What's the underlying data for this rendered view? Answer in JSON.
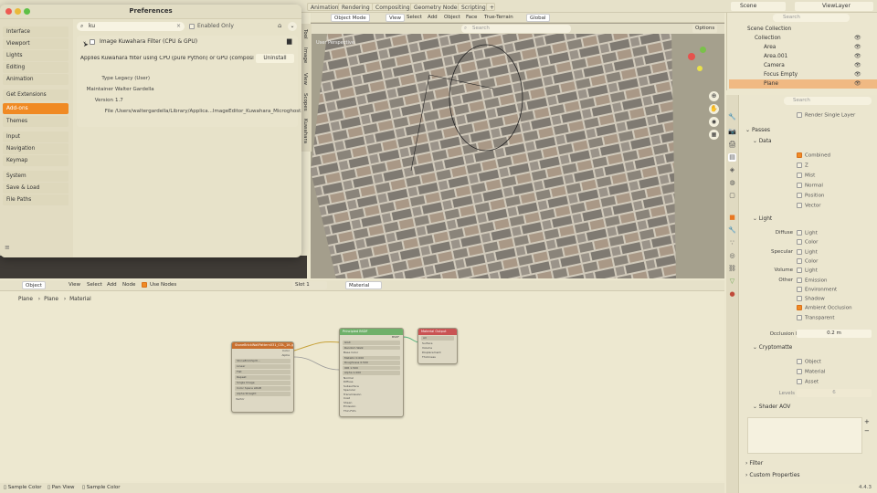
{
  "menubar": {
    "items": [
      "File",
      "Edit",
      "Render",
      "Window",
      "Help"
    ]
  },
  "workspace_tabs": [
    "Animation",
    "Rendering",
    "Compositing",
    "Geometry Nodes",
    "Scripting"
  ],
  "scene": {
    "scene_label": "Scene",
    "view_layer_label": "ViewLayer",
    "search_placeholder": "Search"
  },
  "preferences": {
    "title": "Preferences",
    "search_value": "ku",
    "enabled_only_label": "Enabled Only",
    "sidebar": [
      {
        "label": "Interface"
      },
      {
        "label": "Viewport"
      },
      {
        "label": "Lights"
      },
      {
        "label": "Editing"
      },
      {
        "label": "Animation"
      },
      {
        "label": "Get Extensions"
      },
      {
        "label": "Add-ons"
      },
      {
        "label": "Themes"
      },
      {
        "label": "Input"
      },
      {
        "label": "Navigation"
      },
      {
        "label": "Keymap"
      },
      {
        "label": "System"
      },
      {
        "label": "Save & Load"
      },
      {
        "label": "File Paths"
      }
    ],
    "addon": {
      "name": "Image Kuwahara Filter (CPU & GPU)",
      "description": "Applies Kuwahara filter using CPU (pure Python) or GPU (compositor) ...",
      "uninstall_label": "Uninstall",
      "fields": [
        {
          "key": "Type",
          "value": "Legacy (User)"
        },
        {
          "key": "Maintainer",
          "value": "Walter Gardella"
        },
        {
          "key": "Version",
          "value": "1.7"
        },
        {
          "key": "File",
          "value": "/Users/waltergardella/Library/Applica...ImageEditor_Kuwahara_Microghost.py"
        }
      ]
    }
  },
  "viewport": {
    "mode": "Object Mode",
    "menus": [
      "View",
      "Select",
      "Add",
      "Object",
      "Face",
      "True-Terrain"
    ],
    "orientation": "Global",
    "options_label": "Options",
    "search_placeholder": "Search",
    "side_tabs": [
      "Tool",
      "Image",
      "View",
      "Scopes",
      "Kuwahara"
    ],
    "overlay_text": "User Perspective"
  },
  "outliner": {
    "collection_label": "Scene Collection",
    "items": [
      {
        "label": "Collection"
      },
      {
        "label": "Area"
      },
      {
        "label": "Area.001"
      },
      {
        "label": "Camera"
      },
      {
        "label": "Focus Empty"
      },
      {
        "label": "Plane"
      }
    ]
  },
  "properties": {
    "render_single_layer": "Render Single Layer",
    "passes_label": "Passes",
    "data_label": "Data",
    "data_items": [
      {
        "label": "Combined",
        "on": true
      },
      {
        "label": "Z",
        "on": false
      },
      {
        "label": "Mist",
        "on": false
      },
      {
        "label": "Normal",
        "on": false
      },
      {
        "label": "Position",
        "on": false
      },
      {
        "label": "Vector",
        "on": false
      }
    ],
    "light_label": "Light",
    "light_rows": [
      {
        "group": "Diffuse",
        "label": "Light"
      },
      {
        "group": "",
        "label": "Color"
      },
      {
        "group": "Specular",
        "label": "Light"
      },
      {
        "group": "",
        "label": "Color"
      },
      {
        "group": "Volume",
        "label": "Light"
      },
      {
        "group": "Other",
        "label": "Emission"
      },
      {
        "group": "",
        "label": "Environment"
      },
      {
        "group": "",
        "label": "Shadow"
      },
      {
        "group": "",
        "label": "Ambient Occlusion",
        "on": true
      },
      {
        "group": "",
        "label": "Transparent"
      }
    ],
    "occlusion_label": "Occlusion Distance",
    "occlusion_value": "0.2 m",
    "cryptomatte_label": "Cryptomatte",
    "crypto_items": [
      {
        "label": "Object"
      },
      {
        "label": "Material"
      },
      {
        "label": "Asset"
      }
    ],
    "levels_label": "Levels",
    "levels_value": "6",
    "shader_aov_label": "Shader AOV",
    "filter_label": "Filter",
    "custom_props_label": "Custom Properties",
    "version": "4.4.3"
  },
  "node_editor": {
    "type_label": "Object",
    "menus": [
      "View",
      "Select",
      "Add",
      "Node"
    ],
    "use_nodes_label": "Use Nodes",
    "slot_label": "Slot 1",
    "material_label": "Material",
    "breadcrumb": [
      "Plane",
      "Plane",
      "Material"
    ],
    "image_node": {
      "title": "StoneBrickWallPattern031_COL_1K.jpg",
      "outputs": [
        "Color",
        "Alpha"
      ],
      "fields": [
        "Linear",
        "Flat",
        "Repeat",
        "Single Image",
        "Color Space sRGB",
        "Alpha Straight"
      ],
      "vector": "Vector",
      "filename": "StoneBrickSplit..."
    },
    "bsdf_node": {
      "title": "Principled BSDF",
      "output": "BSDF",
      "rows": [
        "GGX",
        "Random Walk",
        "Base Color",
        "Metallic 0.000",
        "Roughness 0.500",
        "IOR 1.500",
        "Alpha 1.000",
        "Normal",
        "Diffuse",
        "Subsurface",
        "Specular",
        "Transmission",
        "Coat",
        "Sheen",
        "Emission",
        "Thin Film"
      ]
    },
    "output_node": {
      "title": "Material Output",
      "target": "All",
      "inputs": [
        "Surface",
        "Volume",
        "Displacement",
        "Thickness"
      ]
    }
  },
  "statusbar": {
    "items": [
      "Sample Color",
      "Pan View",
      "Sample Color"
    ]
  }
}
